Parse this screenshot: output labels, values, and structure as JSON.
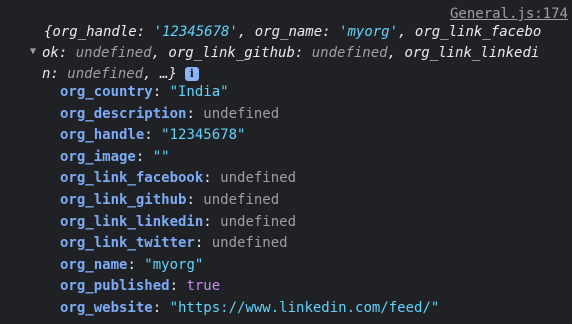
{
  "source": {
    "link_text": "General.js:174"
  },
  "summary": {
    "line1_prefix": "{org_handle: ",
    "line1_handle": "'12345678'",
    "line1_mid": ", org_name: ",
    "line1_name": "'myorg'",
    "line1_tail": ", org_link_facebo",
    "line2_a": "ok: ",
    "line2_b": "undefined",
    "line2_c": ", org_link_github: ",
    "line2_d": "undefined",
    "line2_e": ", org_link_linkedi",
    "line3_a": "n: ",
    "line3_b": "undefined",
    "line3_c": ", …}",
    "info_glyph": "i"
  },
  "properties": [
    {
      "key": "org_country",
      "value": "\"India\"",
      "kind": "string"
    },
    {
      "key": "org_description",
      "value": "undefined",
      "kind": "undefined"
    },
    {
      "key": "org_handle",
      "value": "\"12345678\"",
      "kind": "string"
    },
    {
      "key": "org_image",
      "value": "\"\"",
      "kind": "string"
    },
    {
      "key": "org_link_facebook",
      "value": "undefined",
      "kind": "undefined"
    },
    {
      "key": "org_link_github",
      "value": "undefined",
      "kind": "undefined"
    },
    {
      "key": "org_link_linkedin",
      "value": "undefined",
      "kind": "undefined"
    },
    {
      "key": "org_link_twitter",
      "value": "undefined",
      "kind": "undefined"
    },
    {
      "key": "org_name",
      "value": "\"myorg\"",
      "kind": "string"
    },
    {
      "key": "org_published",
      "value": "true",
      "kind": "boolean"
    },
    {
      "key": "org_website",
      "value": "\"https://www.linkedin.com/feed/\"",
      "kind": "string"
    }
  ],
  "colors": {
    "background": "#202124",
    "key": "#7cacf8",
    "string": "#5cd5fb",
    "undefined": "#9aa0a6",
    "boolean": "#c58af9"
  }
}
